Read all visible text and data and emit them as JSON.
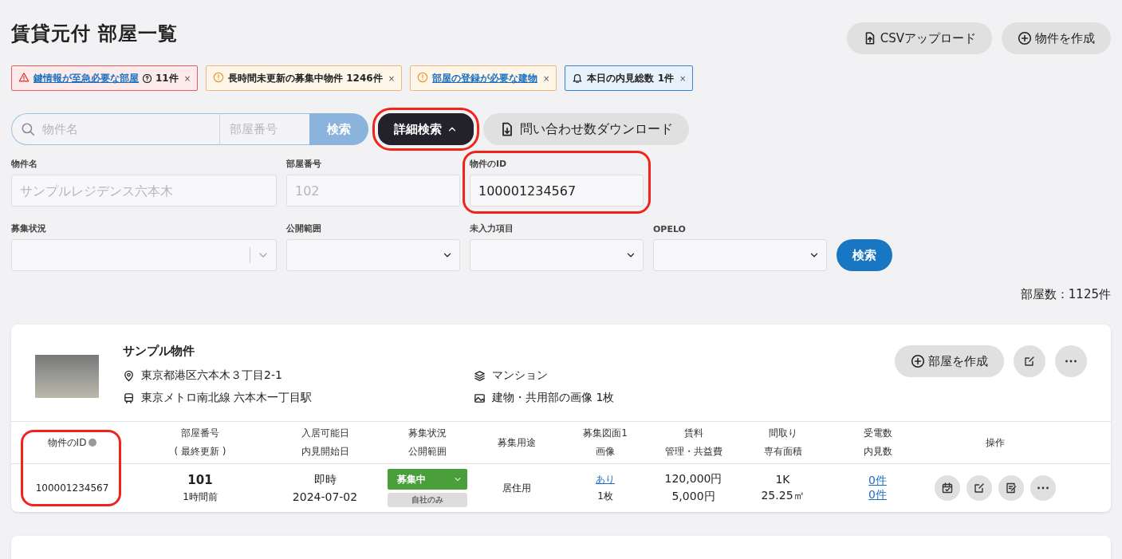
{
  "title": "賃貸元付 部屋一覧",
  "header_buttons": [
    {
      "kind": "upload",
      "label": "CSVアップロード"
    },
    {
      "kind": "create",
      "label": "物件を作成"
    }
  ],
  "alerts": [
    {
      "kind": "error",
      "link": "鍵情報が至急必要な部屋",
      "help": true,
      "text": "11件",
      "close": "×"
    },
    {
      "kind": "warning",
      "text": "長時間未更新の募集中物件 1246件",
      "close": "×"
    },
    {
      "kind": "warning",
      "link": "部屋の登録が必要な建物",
      "close": "×"
    },
    {
      "kind": "info",
      "text": "本日の内見総数 1件",
      "close": "×"
    }
  ],
  "search": {
    "name_placeholder": "物件名",
    "room_placeholder": "部屋番号",
    "button": "検索"
  },
  "advanced_button": {
    "label": "詳細検索",
    "expanded": true,
    "highlighted": true
  },
  "download_button": {
    "label": "問い合わせ数ダウンロード"
  },
  "filters_row_1": [
    {
      "label": "物件名",
      "placeholder": "サンプルレジデンス六本木"
    },
    {
      "label": "部屋番号",
      "placeholder": "102"
    },
    {
      "label": "物件のID",
      "value": "100001234567",
      "highlighted": true
    }
  ],
  "filters_row_2": [
    {
      "label": "募集状況",
      "kind": "combo"
    },
    {
      "label": "公開範囲",
      "kind": "select"
    },
    {
      "label": "未入力項目",
      "kind": "select"
    },
    {
      "label": "OPELO",
      "kind": "select"
    }
  ],
  "filter_button": "検索",
  "room_count": "部屋数：1125件",
  "property": {
    "name": "サンプル物件",
    "address": "東京都港区六本木３丁目2-1",
    "station": "東京メトロ南北線 六本木一丁目駅",
    "type": "マンション",
    "images": "建物・共用部の画像 1枚",
    "create_room": "部屋を作成"
  },
  "table": {
    "columns": [
      {
        "lines": [
          "物件のID"
        ],
        "help": true,
        "highlighted": true
      },
      {
        "lines": [
          "部屋番号",
          "( 最終更新 )"
        ]
      },
      {
        "lines": [
          "入居可能日",
          "内見開始日"
        ]
      },
      {
        "lines": [
          "募集状況",
          "公開範囲"
        ]
      },
      {
        "lines": [
          "募集用途"
        ]
      },
      {
        "lines": [
          "募集図面1",
          "画像"
        ]
      },
      {
        "lines": [
          "賃料",
          "管理・共益費"
        ]
      },
      {
        "lines": [
          "間取り",
          "専有面積"
        ]
      },
      {
        "lines": [
          "受電数",
          "内見数"
        ]
      },
      {
        "lines": [
          "操作"
        ]
      }
    ],
    "rows": [
      {
        "property_id": "100001234567",
        "room_number": "101",
        "updated": "1時間前",
        "move_in": "即時",
        "viewing_start": "2024-07-02",
        "status": "募集中",
        "scope": "自社のみ",
        "use": "居住用",
        "drawing_link": "あり",
        "image_count": "1枚",
        "rent": "120,000円",
        "fee": "5,000円",
        "layout": "1K",
        "area": "25.25㎡",
        "calls": "0件",
        "viewings": "0件"
      }
    ]
  }
}
